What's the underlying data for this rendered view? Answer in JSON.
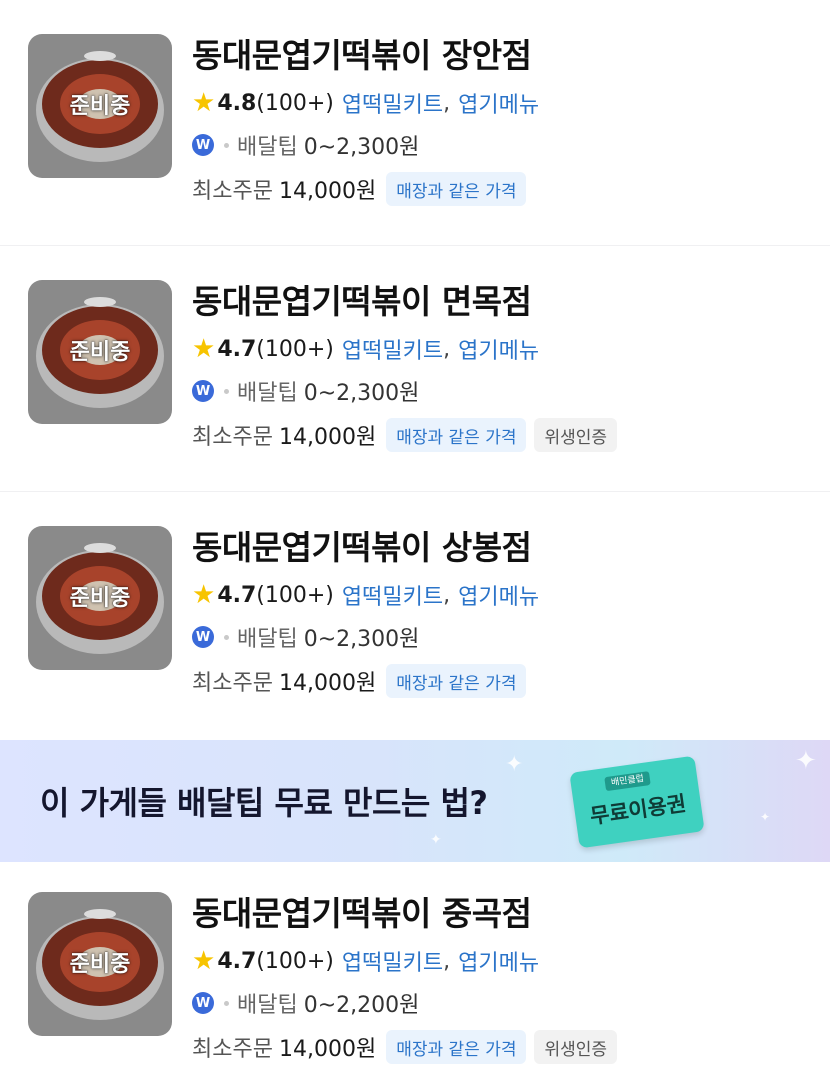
{
  "stores": [
    {
      "thumb_label": "준비중",
      "name": "동대문엽기떡볶이 장안점",
      "rating": "4.8",
      "review_count": "(100+)",
      "menus": [
        "엽떡밀키트",
        "엽기메뉴"
      ],
      "menu_sep": ",",
      "delivery_label": "배달팁",
      "delivery_tip": "0~2,300원",
      "min_order_label": "최소주문",
      "min_order": "14,000원",
      "badges": [
        "매장과 같은 가격"
      ]
    },
    {
      "thumb_label": "준비중",
      "name": "동대문엽기떡볶이 면목점",
      "rating": "4.7",
      "review_count": "(100+)",
      "menus": [
        "엽떡밀키트",
        "엽기메뉴"
      ],
      "menu_sep": ",",
      "delivery_label": "배달팁",
      "delivery_tip": "0~2,300원",
      "min_order_label": "최소주문",
      "min_order": "14,000원",
      "badges": [
        "매장과 같은 가격",
        "위생인증"
      ]
    },
    {
      "thumb_label": "준비중",
      "name": "동대문엽기떡볶이 상봉점",
      "rating": "4.7",
      "review_count": "(100+)",
      "menus": [
        "엽떡밀키트",
        "엽기메뉴"
      ],
      "menu_sep": ",",
      "delivery_label": "배달팁",
      "delivery_tip": "0~2,300원",
      "min_order_label": "최소주문",
      "min_order": "14,000원",
      "badges": [
        "매장과 같은 가격"
      ]
    },
    {
      "thumb_label": "준비중",
      "name": "동대문엽기떡볶이 중곡점",
      "rating": "4.7",
      "review_count": "(100+)",
      "menus": [
        "엽떡밀키트",
        "엽기메뉴"
      ],
      "menu_sep": ",",
      "delivery_label": "배달팁",
      "delivery_tip": "0~2,200원",
      "min_order_label": "최소주문",
      "min_order": "14,000원",
      "badges": [
        "매장과 같은 가격",
        "위생인증"
      ]
    }
  ],
  "banner": {
    "text": "이 가게들 배달팁 무료 만드는 법?",
    "coupon_small": "배민클럽",
    "coupon_main": "무료이용권"
  },
  "icons": {
    "rating": "star-icon",
    "delivery_logo": "delivery-service-icon"
  },
  "colors": {
    "star": "#f7c400",
    "menu_link": "#2b74c9",
    "badge_blue_bg": "#eaf3fd",
    "coupon": "#3fd1c0"
  }
}
